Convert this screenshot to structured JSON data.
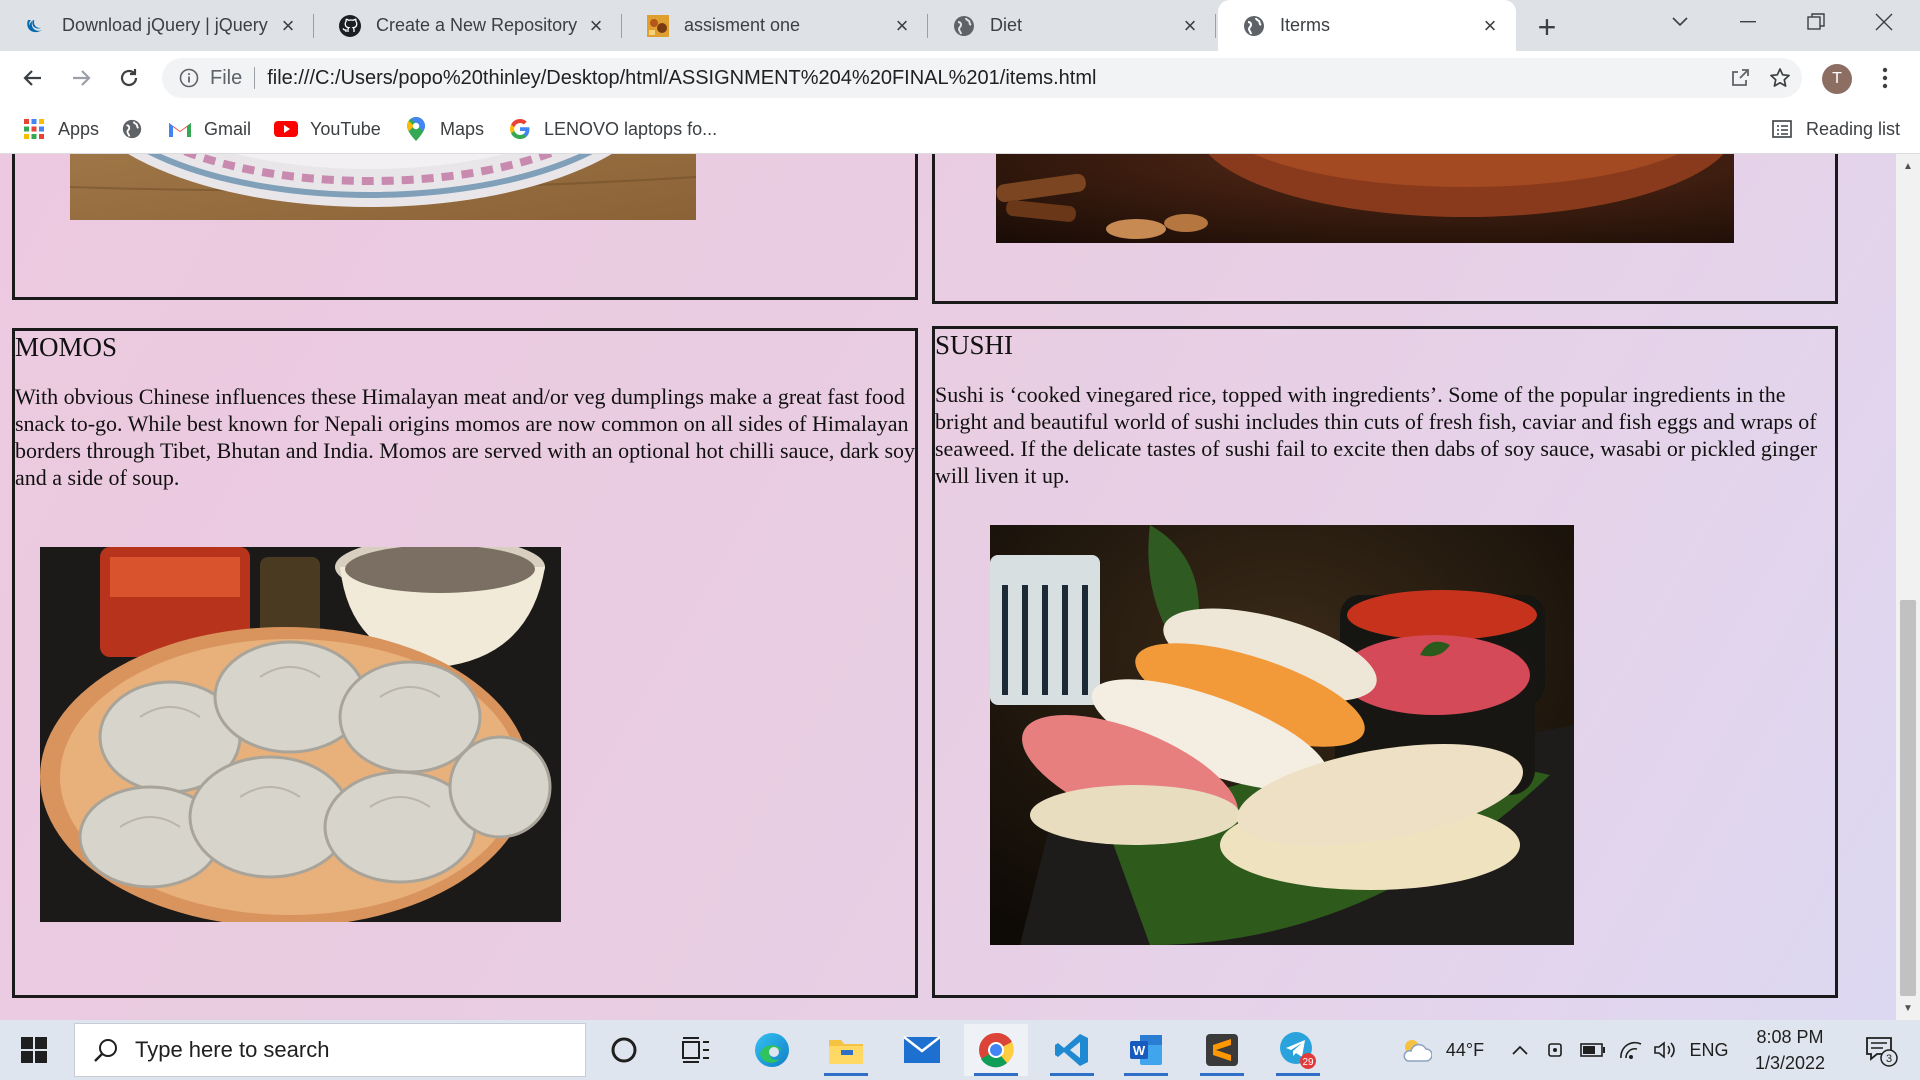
{
  "browser": {
    "tabs": [
      {
        "title": "Download jQuery | jQuery",
        "icon": "jquery-icon"
      },
      {
        "title": "Create a New Repository",
        "icon": "github-icon"
      },
      {
        "title": "assisment one",
        "icon": "page-thumbnail-icon"
      },
      {
        "title": "Diet",
        "icon": "globe-icon"
      },
      {
        "title": "Iterms",
        "icon": "globe-icon",
        "active": true
      }
    ],
    "address_bar": {
      "scheme_label": "File",
      "url": "file:///C:/Users/popo%20thinley/Desktop/html/ASSIGNMENT%204%20FINAL%201/items.html"
    },
    "profile_initial": "T",
    "bookmarks": [
      {
        "label": "Apps",
        "icon": "apps-grid-icon"
      },
      {
        "label": "",
        "icon": "globe-icon"
      },
      {
        "label": "Gmail",
        "icon": "gmail-icon"
      },
      {
        "label": "YouTube",
        "icon": "youtube-icon"
      },
      {
        "label": "Maps",
        "icon": "maps-pin-icon"
      },
      {
        "label": "LENOVO laptops fo...",
        "icon": "google-g-icon"
      }
    ],
    "reading_list_label": "Reading list"
  },
  "page": {
    "cards": [
      {
        "title": "MOMOS",
        "description": "With obvious Chinese influences these Himalayan meat and/or veg dumplings make a great fast food snack to-go. While best known for Nepali origins momos are now common on all sides of Himalayan borders through Tibet, Bhutan and India. Momos are served with an optional hot chilli sauce, dark soy and a side of soup."
      },
      {
        "title": "SUSHI",
        "description": "Sushi is ‘cooked vinegared rice, topped with ingredients’. Some of the popular ingredients in the bright and beautiful world of sushi includes thin cuts of fresh fish, caviar and fish eggs and wraps of seaweed. If the delicate tastes of sushi fail to excite then dabs of soy sauce, wasabi or pickled ginger will liven it up."
      }
    ]
  },
  "taskbar": {
    "search_placeholder": "Type here to search",
    "weather": "44°F",
    "language": "ENG",
    "time": "8:08 PM",
    "date": "1/3/2022",
    "telegram_badge": "29",
    "notification_count": "3"
  },
  "colors": {
    "page_background": "#ecc9e0",
    "card_border": "#1a1a1a",
    "chrome_tabstrip": "#dee1e6",
    "taskbar": "#dfe5ee"
  }
}
